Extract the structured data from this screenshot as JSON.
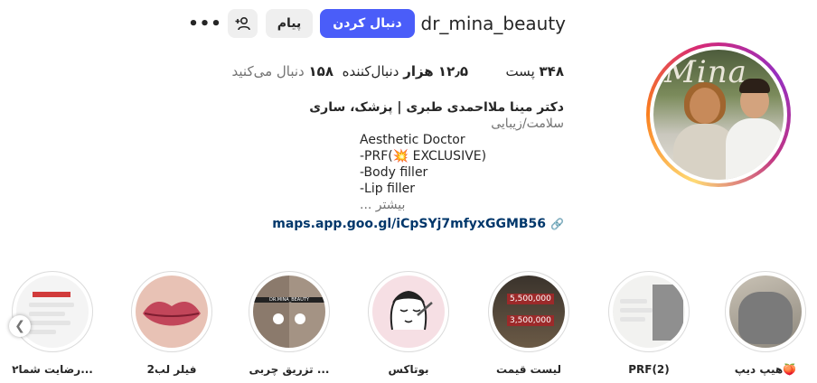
{
  "profile": {
    "username": "dr_mina_beauty",
    "avatar_logo_text": "Mina"
  },
  "actions": {
    "follow_label": "دنبال کردن",
    "message_label": "پیام",
    "add_user_icon": "person-plus-icon",
    "more_icon": "ellipsis-icon",
    "more_glyph": "•••"
  },
  "stats": {
    "posts_count": "۳۴۸",
    "posts_label": "پست",
    "followers_count": "۱۲٫۵ هزار",
    "followers_label": "دنبال‌کننده",
    "following_count": "۱۵۸",
    "following_label": "دنبال می‌کنید"
  },
  "bio": {
    "name": "دکتر مینا ملااحمدی طبری | پزشک، ساری",
    "category": "سلامت/زیبایی",
    "lines": {
      "line1": "Aesthetic Doctor",
      "line2_prefix": "-PRF(",
      "line2_emoji": "💥",
      "line2_suffix": " EXCLUSIVE)",
      "line3": "-Body filler",
      "line4": "-Lip filler"
    },
    "more": "بیشتر ...",
    "link": "maps.app.goo.gl/iCpSYj7mfyxGGMB56"
  },
  "highlights": [
    {
      "label": "هیپ دیپ🍑"
    },
    {
      "label": "PRF(2)"
    },
    {
      "label": "لیست قیمت"
    },
    {
      "label": "بوتاکس"
    },
    {
      "label": "تزریق چربی ..."
    },
    {
      "label": "فیلر لب2"
    },
    {
      "label": "رضایت شما۲..."
    }
  ],
  "highlight_thumb_text": {
    "before_after": "DR.MINA_BEAUTY",
    "price_1": "5,500,000",
    "price_2": "3,500,000"
  },
  "nav": {
    "prev_icon": "chevron-left-icon",
    "prev_glyph": "❮"
  },
  "colors": {
    "follow": "#4a5df9",
    "link": "#00376b"
  }
}
